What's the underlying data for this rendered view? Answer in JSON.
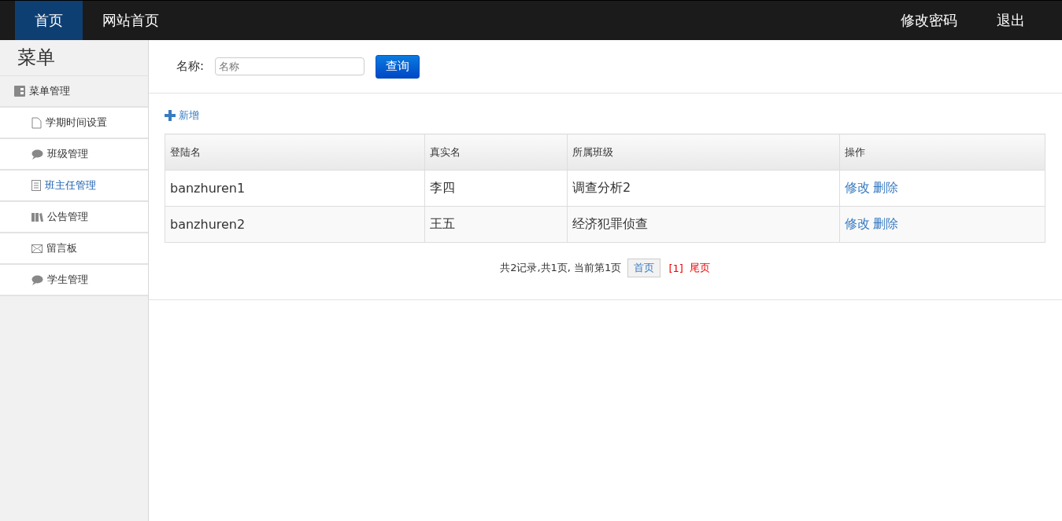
{
  "topnav": {
    "left": [
      {
        "label": "首页",
        "selected": true
      },
      {
        "label": "网站首页",
        "selected": false
      }
    ],
    "right": [
      "修改密码",
      "退出"
    ]
  },
  "sidebar": {
    "title": "菜单",
    "group": "菜单管理",
    "items": [
      {
        "label": "学期时间设置",
        "kind": "page",
        "selected": false
      },
      {
        "label": "班级管理",
        "kind": "comment",
        "selected": false
      },
      {
        "label": "班主任管理",
        "kind": "list",
        "selected": true
      },
      {
        "label": "公告管理",
        "kind": "books",
        "selected": false
      },
      {
        "label": "留言板",
        "kind": "mail",
        "selected": false
      },
      {
        "label": "学生管理",
        "kind": "comment",
        "selected": false
      }
    ]
  },
  "search": {
    "label": "名称:",
    "placeholder": "名称",
    "button": "查询"
  },
  "add_link": "新增",
  "table": {
    "columns": [
      "登陆名",
      "真实名",
      "所属班级",
      "操作"
    ],
    "rows": [
      {
        "cells": [
          "banzhuren1",
          "李四",
          "调查分析2"
        ],
        "actions": [
          "修改",
          "删除"
        ]
      },
      {
        "cells": [
          "banzhuren2",
          "王五",
          "经济犯罪侦查"
        ],
        "actions": [
          "修改",
          "删除"
        ]
      }
    ]
  },
  "pagination": {
    "summary": "共2记录,共1页, 当前第1页",
    "first": "首页",
    "pages": "[1]",
    "last": "尾页"
  }
}
